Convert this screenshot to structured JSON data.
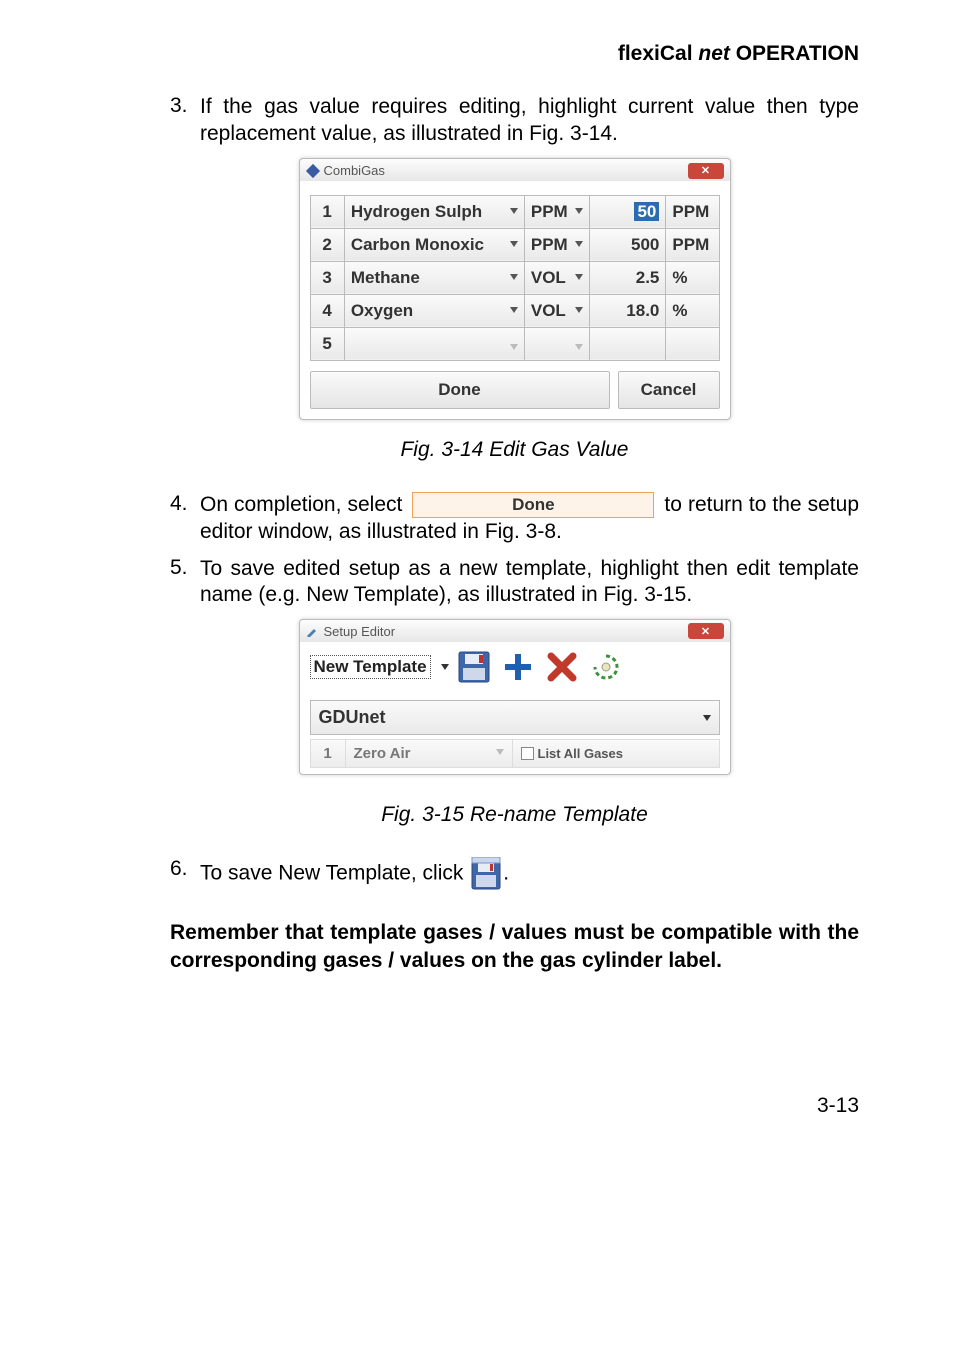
{
  "header": {
    "prefix": "flexiCal ",
    "italic": "net",
    "suffix": " OPERATION"
  },
  "step3": {
    "num": "3.",
    "text": "If the gas value requires editing, highlight current value then type replacement value, as illustrated in Fig. 3-14."
  },
  "combigas": {
    "title": "CombiGas",
    "rows": [
      {
        "idx": "1",
        "gas": "Hydrogen Sulph",
        "unit": "PPM",
        "val": "50",
        "u2": "PPM",
        "highlight": true
      },
      {
        "idx": "2",
        "gas": "Carbon Monoxic",
        "unit": "PPM",
        "val": "500",
        "u2": "PPM"
      },
      {
        "idx": "3",
        "gas": "Methane",
        "unit": "VOL",
        "val": "2.5",
        "u2": "%"
      },
      {
        "idx": "4",
        "gas": "Oxygen",
        "unit": "VOL",
        "val": "18.0",
        "u2": "%"
      },
      {
        "idx": "5",
        "gas": "",
        "unit": "",
        "val": "",
        "u2": ""
      }
    ],
    "done": "Done",
    "cancel": "Cancel"
  },
  "caption314": "Fig. 3-14  Edit Gas Value",
  "step4": {
    "num": "4.",
    "pre": "On completion, select ",
    "btn": "Done",
    "post": " to return to the setup editor window, as illustrated in Fig. 3-8."
  },
  "step5": {
    "num": "5.",
    "text": "To save edited setup as a new template, highlight then edit template name (e.g. New Template), as illustrated in Fig. 3-15."
  },
  "setupEditor": {
    "title": "Setup Editor",
    "templateName": "New Template",
    "device": "GDUnet",
    "row": {
      "idx": "1",
      "gas": "Zero Air",
      "listAll": "List All Gases"
    }
  },
  "caption315": "Fig. 3-15  Re-name Template",
  "step6": {
    "num": "6.",
    "pre": "To save New Template, click ",
    "post": "."
  },
  "note": "Remember that template gases / values must be compatible with the corresponding gases / values on the gas cylinder label.",
  "pageNum": "3-13"
}
